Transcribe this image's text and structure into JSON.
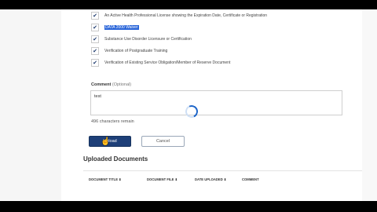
{
  "checklist": [
    {
      "label": "An Active Health Professional License showing the Expiration Date, Certificate or Registration",
      "checked": true,
      "highlighted": false
    },
    {
      "label": "DATA 2000 Waiver",
      "checked": true,
      "highlighted": true
    },
    {
      "label": "Substance Use Disorder Licensure or Certification",
      "checked": true,
      "highlighted": false
    },
    {
      "label": "Verification of Postgraduate Training",
      "checked": true,
      "highlighted": false
    },
    {
      "label": "Verification of Existing Service Obligation/Member of Reserve Document",
      "checked": true,
      "highlighted": false
    }
  ],
  "comment": {
    "label": "Comment",
    "optional": "(Optional)",
    "value": "test",
    "remaining": "496 characters remain"
  },
  "buttons": {
    "upload": "Upload",
    "cancel": "Cancel"
  },
  "uploaded": {
    "title": "Uploaded Documents",
    "columns": [
      "DOCUMENT TITLE ⬍",
      "DOCUMENT FILE ⬍",
      "DATE UPLOADED ⬍",
      "COMMENT"
    ]
  },
  "colors": {
    "primary": "#1e3f78",
    "spinner": "#1e66c9",
    "highlight": "#2b66d9"
  }
}
